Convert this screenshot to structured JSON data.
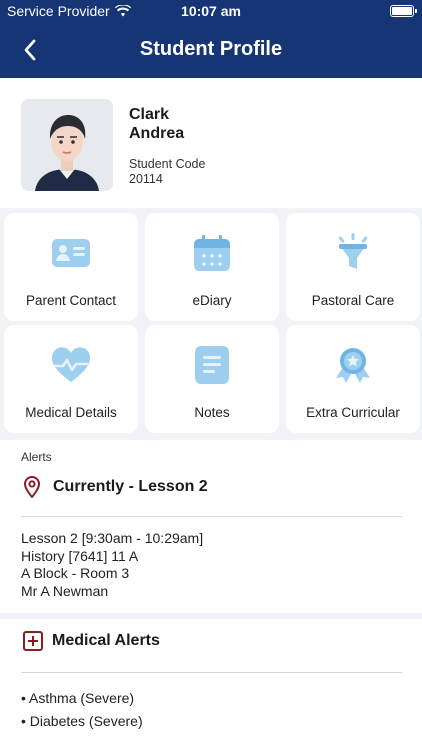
{
  "status_bar": {
    "carrier": "Service Provider",
    "time": "10:07 am"
  },
  "nav": {
    "title": "Student Profile"
  },
  "student": {
    "last_name": "Clark",
    "first_name": "Andrea",
    "code_label": "Student Code",
    "code": "20114"
  },
  "tiles": [
    {
      "label": "Parent Contact",
      "icon": "contact-card-icon"
    },
    {
      "label": "eDiary",
      "icon": "calendar-icon"
    },
    {
      "label": "Pastoral Care",
      "icon": "funnel-lamp-icon"
    },
    {
      "label": "Medical Details",
      "icon": "heart-pulse-icon"
    },
    {
      "label": "Notes",
      "icon": "notes-icon"
    },
    {
      "label": "Extra Curricular",
      "icon": "award-ribbon-icon"
    }
  ],
  "alerts": {
    "section_label": "Alerts",
    "current_title": "Currently - Lesson 2",
    "lesson_lines": [
      "Lesson 2 [9:30am - 10:29am]",
      "History [7641] 11 A",
      "A Block - Room 3",
      "Mr A Newman"
    ]
  },
  "medical": {
    "title": "Medical Alerts",
    "items": [
      "• Asthma (Severe)",
      "• Diabetes (Severe)"
    ]
  },
  "colors": {
    "header": "#163574",
    "tile_icon": "#9fcfef",
    "alert_icon": "#8a1c24",
    "background": "#f2f3f6"
  }
}
